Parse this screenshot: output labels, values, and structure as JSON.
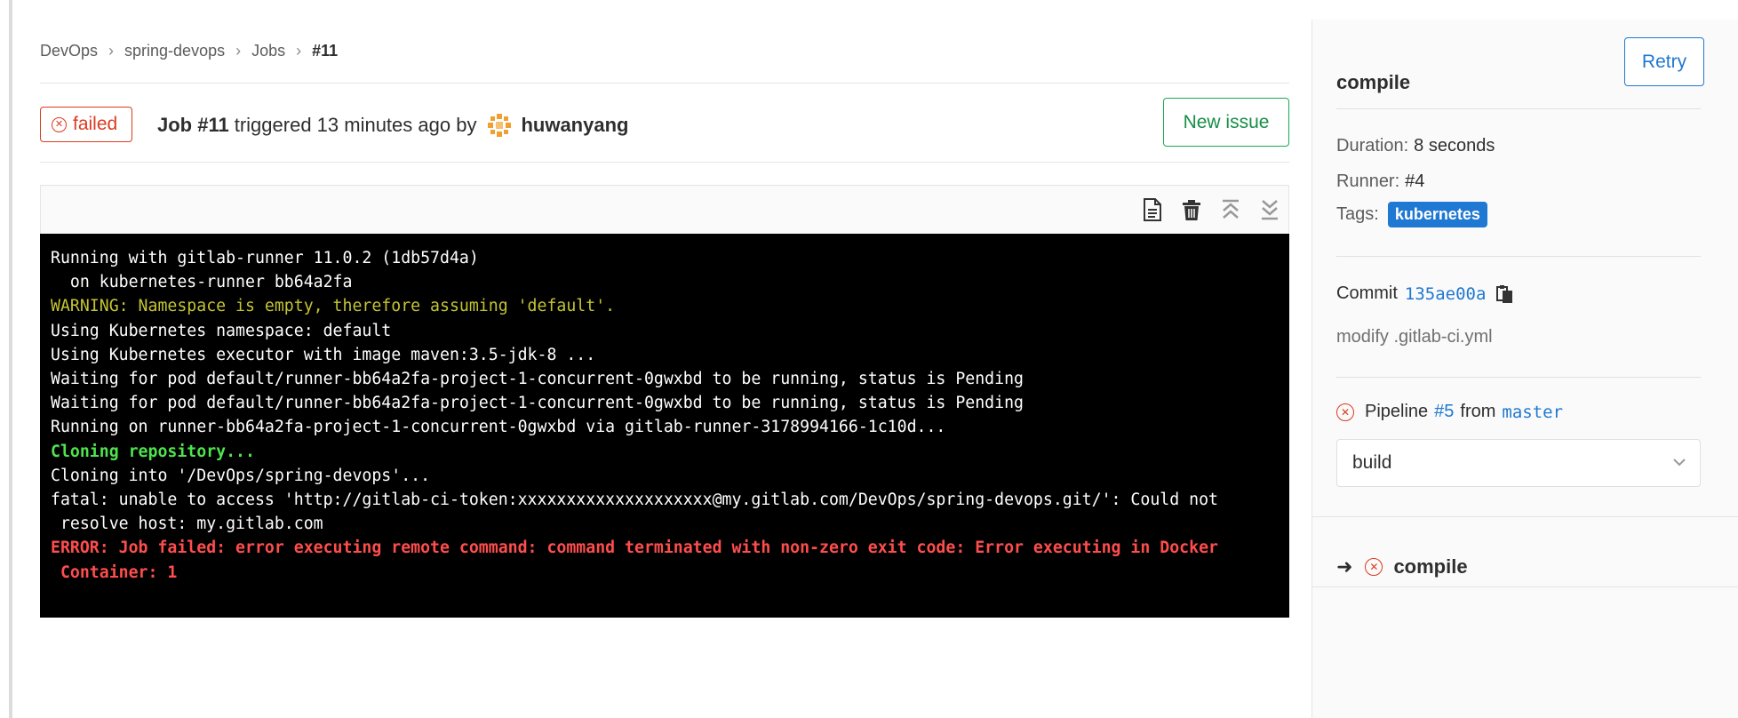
{
  "breadcrumb": {
    "items": [
      "DevOps",
      "spring-devops",
      "Jobs"
    ],
    "current": "#11"
  },
  "job": {
    "status": "failed",
    "title": "Job #11",
    "triggered_text": "triggered 13 minutes ago by",
    "user": "huwanyang",
    "new_issue_label": "New issue"
  },
  "log_lines": [
    {
      "text": "Running with gitlab-runner 11.0.2 (1db57d4a)",
      "kind": "normal"
    },
    {
      "text": "  on kubernetes-runner bb64a2fa",
      "kind": "normal"
    },
    {
      "text": "WARNING: Namespace is empty, therefore assuming 'default'.",
      "kind": "warn"
    },
    {
      "text": "Using Kubernetes namespace: default",
      "kind": "normal"
    },
    {
      "text": "Using Kubernetes executor with image maven:3.5-jdk-8 ...",
      "kind": "normal"
    },
    {
      "text": "Waiting for pod default/runner-bb64a2fa-project-1-concurrent-0gwxbd to be running, status is Pending",
      "kind": "normal"
    },
    {
      "text": "Waiting for pod default/runner-bb64a2fa-project-1-concurrent-0gwxbd to be running, status is Pending",
      "kind": "normal"
    },
    {
      "text": "Running on runner-bb64a2fa-project-1-concurrent-0gwxbd via gitlab-runner-3178994166-1c10d...",
      "kind": "normal"
    },
    {
      "text": "Cloning repository...",
      "kind": "ok"
    },
    {
      "text": "Cloning into '/DevOps/spring-devops'...",
      "kind": "normal"
    },
    {
      "text": "fatal: unable to access 'http://gitlab-ci-token:xxxxxxxxxxxxxxxxxxxx@my.gitlab.com/DevOps/spring-devops.git/': Could not",
      "kind": "normal"
    },
    {
      "text": " resolve host: my.gitlab.com",
      "kind": "normal"
    },
    {
      "text": "ERROR: Job failed: error executing remote command: command terminated with non-zero exit code: Error executing in Docker",
      "kind": "err"
    },
    {
      "text": " Container: 1",
      "kind": "err"
    }
  ],
  "toolbar_icons": [
    "raw-log-icon",
    "erase-log-icon",
    "scroll-top-icon",
    "scroll-bottom-icon"
  ],
  "sidebar": {
    "job_name": "compile",
    "retry_label": "Retry",
    "duration_label": "Duration:",
    "duration_value": "8 seconds",
    "runner_label": "Runner:",
    "runner_value": "#4",
    "tags_label": "Tags:",
    "tag": "kubernetes",
    "commit_label": "Commit",
    "commit_sha": "135ae00a",
    "commit_message": "modify .gitlab-ci.yml",
    "pipeline_label": "Pipeline",
    "pipeline_id": "#5",
    "from_label": "from",
    "branch": "master",
    "stage_selected": "build",
    "jobs": [
      {
        "name": "compile",
        "status": "failed"
      }
    ]
  },
  "colors": {
    "failed": "#db3b21",
    "success_green": "#1aaa55",
    "link_blue": "#1f78d1",
    "log_bg": "#000000",
    "log_warn": "#c4c433",
    "log_ok": "#4ee44e",
    "log_err": "#ff4d4d"
  }
}
